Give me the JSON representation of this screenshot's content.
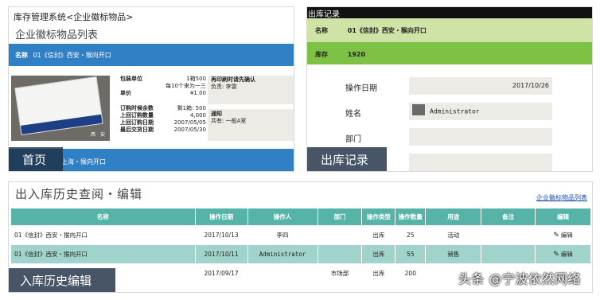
{
  "top_left": {
    "breadcrumb": "库存管理系统<企业徽标物品>",
    "page_title": "企业徽标物品列表",
    "item_bar": {
      "label": "名称",
      "value": "01《信封》西安・猴向开口"
    },
    "photo_tag": "西　安",
    "info_rows": [
      {
        "k": "包装单位",
        "v": "1箱500"
      },
      {
        "k": "",
        "v": "每10个来为一三"
      },
      {
        "k": "单价",
        "v": "¥1.00"
      }
    ],
    "stock_rows": [
      {
        "k": "订购时候余数",
        "v": "剩1箱: 500"
      },
      {
        "k": "上回订购数量",
        "v": "4,000"
      },
      {
        "k": "上回订购日期",
        "v": "2007/05/05"
      },
      {
        "k": "最后交货日期",
        "v": "2007/05/30"
      }
    ],
    "notice1": {
      "title": "再印刷时请先确认",
      "line": "负责: 李雷"
    },
    "notice2": {
      "title": "通知",
      "line": "共有: 一般A室"
    },
    "bottom_bar": "上海・猴向开口",
    "overlay": "首页"
  },
  "top_right": {
    "header": "出库记录",
    "name_row": {
      "label": "名称",
      "value": "01《信封》西安・猴向开口"
    },
    "stock_row": {
      "label": "库存",
      "value": "1920"
    },
    "fields": [
      {
        "label": "操作日期",
        "value": "2017/10/26"
      },
      {
        "label": "姓名",
        "value": "Administrator"
      },
      {
        "label": "部门",
        "value": ""
      },
      {
        "label": "",
        "value": ""
      }
    ],
    "overlay": "出库记录"
  },
  "bottom": {
    "title": "出入库历史查阅・编辑",
    "link": "企业徽标物品列表",
    "columns": [
      "名称",
      "操作日期",
      "操作人",
      "部门",
      "操作类型",
      "操作数量",
      "用途",
      "备注",
      "编辑"
    ],
    "rows": [
      [
        "01《信封》西安・猴向开口",
        "2017/10/13",
        "李四",
        "",
        "出库",
        "25",
        "活动",
        "",
        "编辑"
      ],
      [
        "01《信封》西安・猴向开口",
        "2017/10/11",
        "Administrator",
        "",
        "出库",
        "55",
        "销售",
        "",
        "编辑"
      ],
      [
        "",
        "2017/09/17",
        "",
        "市场部",
        "出库",
        "200",
        "",
        "",
        ""
      ]
    ],
    "overlay": "入库历史编辑",
    "watermark": "头条 @宁波依然网络"
  },
  "colors": {
    "blue_bar": "#2f80c5",
    "teal_header": "#56b3a8",
    "teal_row": "#9fd3cb",
    "green_light": "#cfe3a6",
    "green": "#7dc244"
  }
}
